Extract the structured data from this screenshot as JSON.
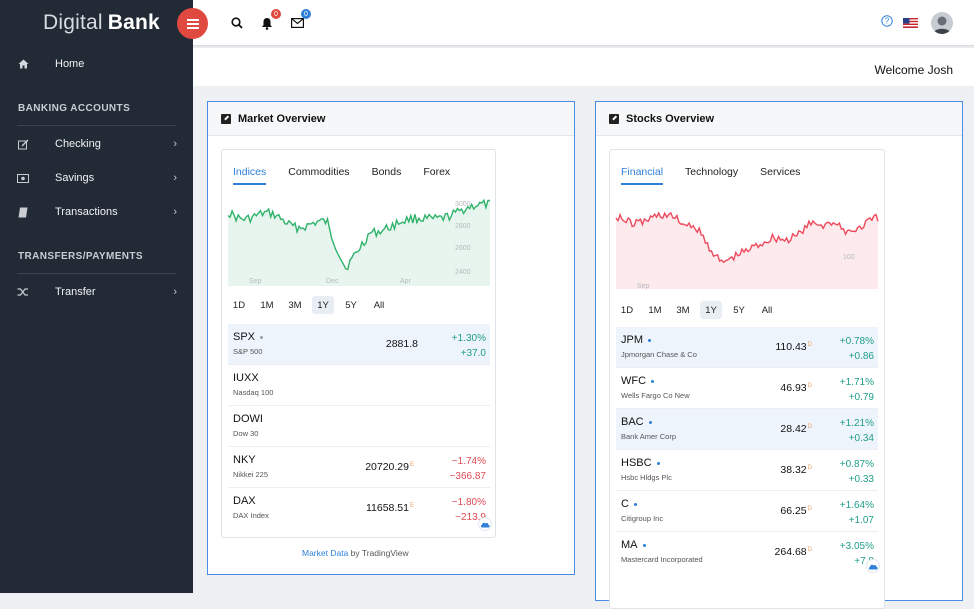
{
  "app": {
    "brand_light": "Digital",
    "brand_bold": "Bank"
  },
  "sidebar": {
    "home": "Home",
    "banking_title": "BANKING ACCOUNTS",
    "banking_items": [
      "Checking",
      "Savings",
      "Transactions"
    ],
    "transfers_title": "TRANSFERS/PAYMENTS",
    "transfers_items": [
      "Transfer"
    ]
  },
  "topbar": {
    "notifications_count": "0",
    "messages_count": "0",
    "welcome": "Welcome Josh"
  },
  "colors": {
    "sidebar": "#222a35",
    "accent": "#2f80d8",
    "menu_button": "#e0493f",
    "up": "#1f9e89",
    "down": "#e04a53"
  },
  "market": {
    "title": "Market Overview",
    "tabs": [
      "Indices",
      "Commodities",
      "Bonds",
      "Forex"
    ],
    "active_tab": "Indices",
    "chart_y_ticks": [
      "3000",
      "2800",
      "2600",
      "2400"
    ],
    "chart_x_ticks": [
      "Sep",
      "Dec",
      "Apr"
    ],
    "ranges": [
      "1D",
      "1M",
      "3M",
      "1Y",
      "5Y",
      "All"
    ],
    "active_range": "1Y",
    "rows": [
      {
        "symbol": "SPX",
        "name": "S&P 500",
        "price": "2881.8",
        "pct": "+1.30%",
        "abs": "+37.0"
      },
      {
        "symbol": "IUXX",
        "name": "Nasdaq 100",
        "price": "",
        "pct": "",
        "abs": ""
      },
      {
        "symbol": "DOWI",
        "name": "Dow 30",
        "price": "",
        "pct": "",
        "abs": ""
      },
      {
        "symbol": "NKY",
        "name": "Nikkei 225",
        "price": "20720.29",
        "pct": "−1.74%",
        "abs": "−366.87"
      },
      {
        "symbol": "DAX",
        "name": "DAX Index",
        "price": "11658.51",
        "pct": "−1.80%",
        "abs": "−213.9"
      }
    ],
    "footer_link": "Market Data",
    "footer_by": " by TradingView"
  },
  "stocks": {
    "title": "Stocks Overview",
    "tabs": [
      "Financial",
      "Technology",
      "Services"
    ],
    "active_tab": "Financial",
    "chart_y_ticks": [
      "100"
    ],
    "chart_x_ticks": [
      "Sep"
    ],
    "ranges": [
      "1D",
      "1M",
      "3M",
      "1Y",
      "5Y",
      "All"
    ],
    "active_range": "1Y",
    "rows": [
      {
        "symbol": "JPM",
        "name": "Jpmorgan Chase & Co",
        "price": "110.43",
        "pct": "+0.78%",
        "abs": "+0.86"
      },
      {
        "symbol": "WFC",
        "name": "Wells Fargo Co New",
        "price": "46.93",
        "pct": "+1.71%",
        "abs": "+0.79"
      },
      {
        "symbol": "BAC",
        "name": "Bank Amer Corp",
        "price": "28.42",
        "pct": "+1.21%",
        "abs": "+0.34"
      },
      {
        "symbol": "HSBC",
        "name": "Hsbc Hldgs Plc",
        "price": "38.32",
        "pct": "+0.87%",
        "abs": "+0.33"
      },
      {
        "symbol": "C",
        "name": "Citigroup Inc",
        "price": "66.25",
        "pct": "+1.64%",
        "abs": "+1.07"
      },
      {
        "symbol": "MA",
        "name": "Mastercard Incorporated",
        "price": "264.68",
        "pct": "+3.05%",
        "abs": "+7.8"
      }
    ]
  }
}
